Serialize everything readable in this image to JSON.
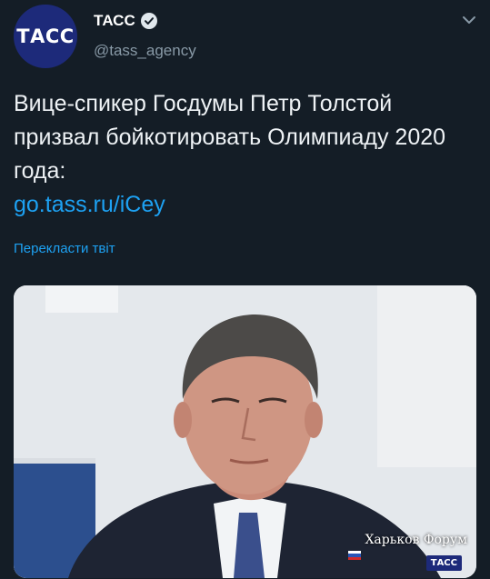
{
  "tweet": {
    "author": {
      "avatar_text": "ТАСС",
      "name": "ТАСС",
      "handle": "@tass_agency",
      "verified": true
    },
    "text": "Вице-спикер Госдумы Петр Толстой призвал бойкотировать Олимпиаду 2020 года:",
    "link": "go.tass.ru/iCey",
    "translate_label": "Перекласти твіт",
    "media": {
      "watermark": "Харьков Форум",
      "logo_text": "ТАСС"
    }
  },
  "colors": {
    "background": "#141d26",
    "link": "#1da1f2",
    "secondary_text": "#8899a6",
    "brand": "#1d2a7a"
  },
  "icons": [
    "verified-badge-icon",
    "chevron-down-icon"
  ]
}
